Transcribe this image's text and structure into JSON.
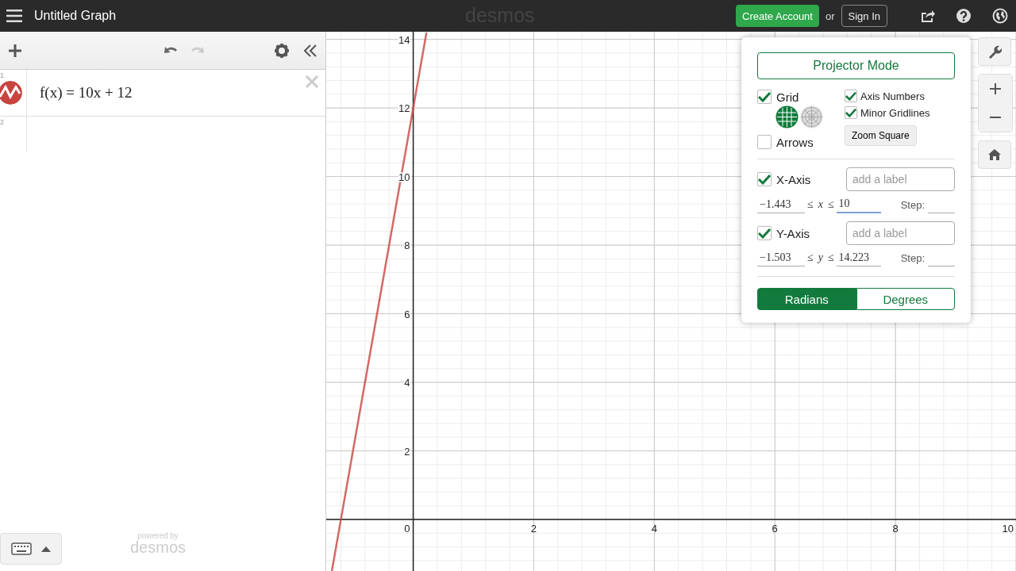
{
  "header": {
    "title": "Untitled Graph",
    "brand": "desmos",
    "create_account": "Create Account",
    "or": "or",
    "sign_in": "Sign In"
  },
  "expression_panel": {
    "expressions": [
      {
        "index": "1",
        "text": "f(x) = 10x + 12",
        "color": "#c74440"
      },
      {
        "index": "2"
      }
    ],
    "footer": {
      "powered_by": "powered by",
      "brand": "desmos"
    }
  },
  "graph": {
    "chart_data": {
      "type": "line",
      "grid": true,
      "x": [
        -1.35,
        0.22
      ],
      "series": [
        {
          "color": "#c74440",
          "values": [
            -1.5,
            14.2
          ]
        }
      ],
      "xlim": [
        -1.443,
        10
      ],
      "ylim": [
        -1.503,
        14.223
      ],
      "xticks": [
        {
          "value": 0,
          "label": "0"
        },
        {
          "value": 2,
          "label": "2"
        },
        {
          "value": 4,
          "label": "4"
        },
        {
          "value": 6,
          "label": "6"
        },
        {
          "value": 8,
          "label": "8"
        },
        {
          "value": 10,
          "label": "10"
        }
      ],
      "yticks": [
        {
          "value": 2,
          "label": "2"
        },
        {
          "value": 4,
          "label": "4"
        },
        {
          "value": 6,
          "label": "6"
        },
        {
          "value": 8,
          "label": "8"
        },
        {
          "value": 10,
          "label": "10"
        },
        {
          "value": 12,
          "label": "12"
        },
        {
          "value": 14,
          "label": "14"
        }
      ]
    }
  },
  "settings": {
    "projector_mode": "Projector Mode",
    "grid": {
      "label": "Grid",
      "checked": true
    },
    "grid_types": [
      {
        "kind": "cartesian",
        "selected": true
      },
      {
        "kind": "polar",
        "selected": false
      }
    ],
    "arrows": {
      "label": "Arrows",
      "checked": false
    },
    "axis_numbers": {
      "label": "Axis Numbers",
      "checked": true
    },
    "minor_gridlines": {
      "label": "Minor Gridlines",
      "checked": true
    },
    "zoom_square": "Zoom Square",
    "axes": [
      {
        "label": "X-Axis",
        "checked": true,
        "placeholder": "add a label",
        "min": "−1.443",
        "relation_1": "≤",
        "variable": "x",
        "relation_2": "≤",
        "max": "10",
        "step_label": "Step:",
        "focused": true
      },
      {
        "label": "Y-Axis",
        "checked": true,
        "placeholder": "add a label",
        "min": "−1.503",
        "relation_1": "≤",
        "variable": "y",
        "relation_2": "≤",
        "max": "14.223",
        "step_label": "Step:",
        "focused": false
      }
    ],
    "angle_units": [
      {
        "label": "Radians",
        "selected": true
      },
      {
        "label": "Degrees",
        "selected": false
      }
    ]
  }
}
